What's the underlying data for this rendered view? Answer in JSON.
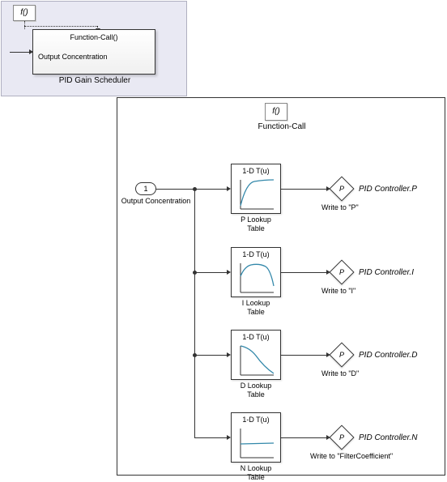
{
  "top": {
    "fcall": "f()",
    "subsystem_fcall": "Function-Call()",
    "subsystem_port": "Output Concentration",
    "caption": "PID Gain Scheduler"
  },
  "main": {
    "fcall": "f()",
    "fcall_label": "Function-Call",
    "inport_num": "1",
    "inport_label": "Output Concentration",
    "luts": [
      {
        "title": "1-D T(u)",
        "caption": "P Lookup\nTable"
      },
      {
        "title": "1-D T(u)",
        "caption": "I Lookup\nTable"
      },
      {
        "title": "1-D T(u)",
        "caption": "D Lookup\nTable"
      },
      {
        "title": "1-D T(u)",
        "caption": "N Lookup\nTable"
      }
    ],
    "writers": [
      {
        "p": "P",
        "target": "PID Controller.P",
        "caption": "Write to \"P\""
      },
      {
        "p": "P",
        "target": "PID Controller.I",
        "caption": "Write to \"I\""
      },
      {
        "p": "P",
        "target": "PID Controller.D",
        "caption": "Write to \"D\""
      },
      {
        "p": "P",
        "target": "PID Controller.N",
        "caption": "Write to \"FilterCoefficient\""
      }
    ]
  }
}
